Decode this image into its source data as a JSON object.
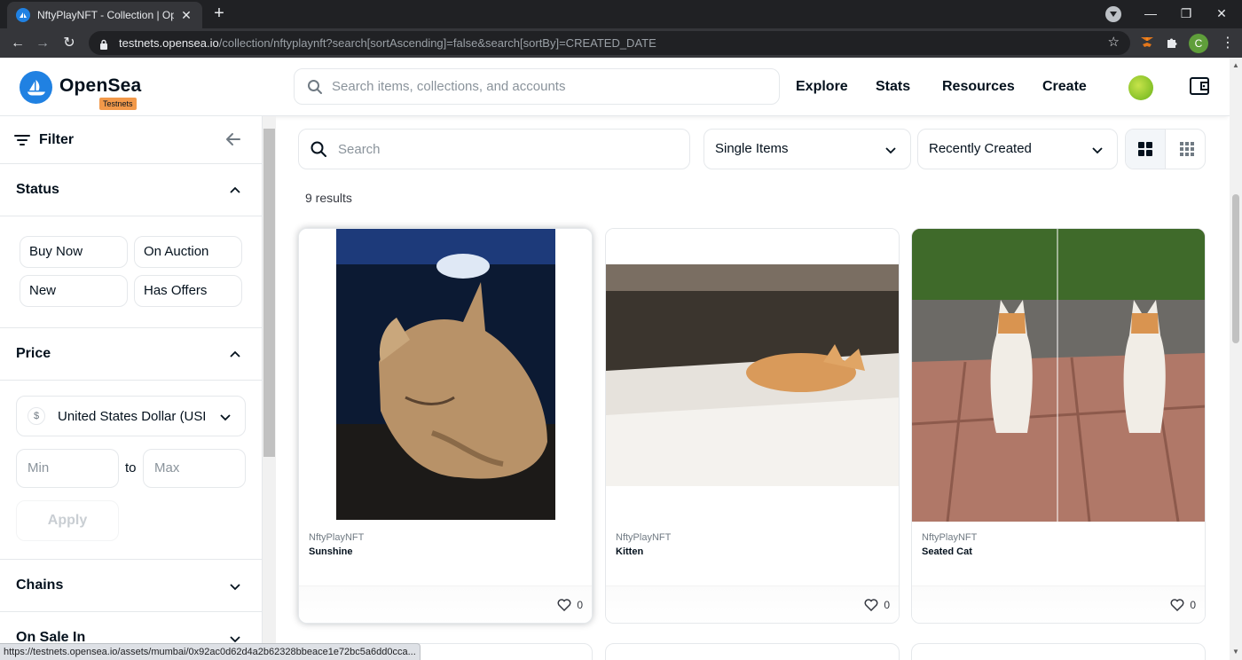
{
  "browser": {
    "tab_title": "NftyPlayNFT - Collection | OpenSea",
    "url_host": "testnets.opensea.io",
    "url_path": "/collection/nftyplaynft?search[sortAscending]=false&search[sortBy]=CREATED_DATE",
    "profile_initial": "C",
    "status_url": "https://testnets.opensea.io/assets/mumbai/0x92ac0d62d4a2b62328bbeace1e72bc5a6dd0cca..."
  },
  "header": {
    "logo_text": "OpenSea",
    "badge": "Testnets",
    "search_placeholder": "Search items, collections, and accounts",
    "nav": [
      "Explore",
      "Stats",
      "Resources",
      "Create"
    ]
  },
  "sidebar": {
    "filter_label": "Filter",
    "status": {
      "title": "Status",
      "options": [
        "Buy Now",
        "On Auction",
        "New",
        "Has Offers"
      ]
    },
    "price": {
      "title": "Price",
      "currency": "United States Dollar (USD)",
      "currency_symbol": "$",
      "min_placeholder": "Min",
      "to_label": "to",
      "max_placeholder": "Max",
      "apply_label": "Apply"
    },
    "chains_title": "Chains",
    "on_sale_title": "On Sale In"
  },
  "main": {
    "search_placeholder": "Search",
    "items_filter": "Single Items",
    "sort": "Recently Created",
    "results": "9 results",
    "cards": [
      {
        "collection": "NftyPlayNFT",
        "name": "Sunshine",
        "likes": "0"
      },
      {
        "collection": "NftyPlayNFT",
        "name": "Kitten",
        "likes": "0"
      },
      {
        "collection": "NftyPlayNFT",
        "name": "Seated Cat",
        "likes": "0"
      }
    ]
  },
  "colors": {
    "brand_blue": "#2081e2",
    "testnet_orange": "#f2994a",
    "text_primary": "#04111d",
    "border": "#e5e8eb"
  }
}
